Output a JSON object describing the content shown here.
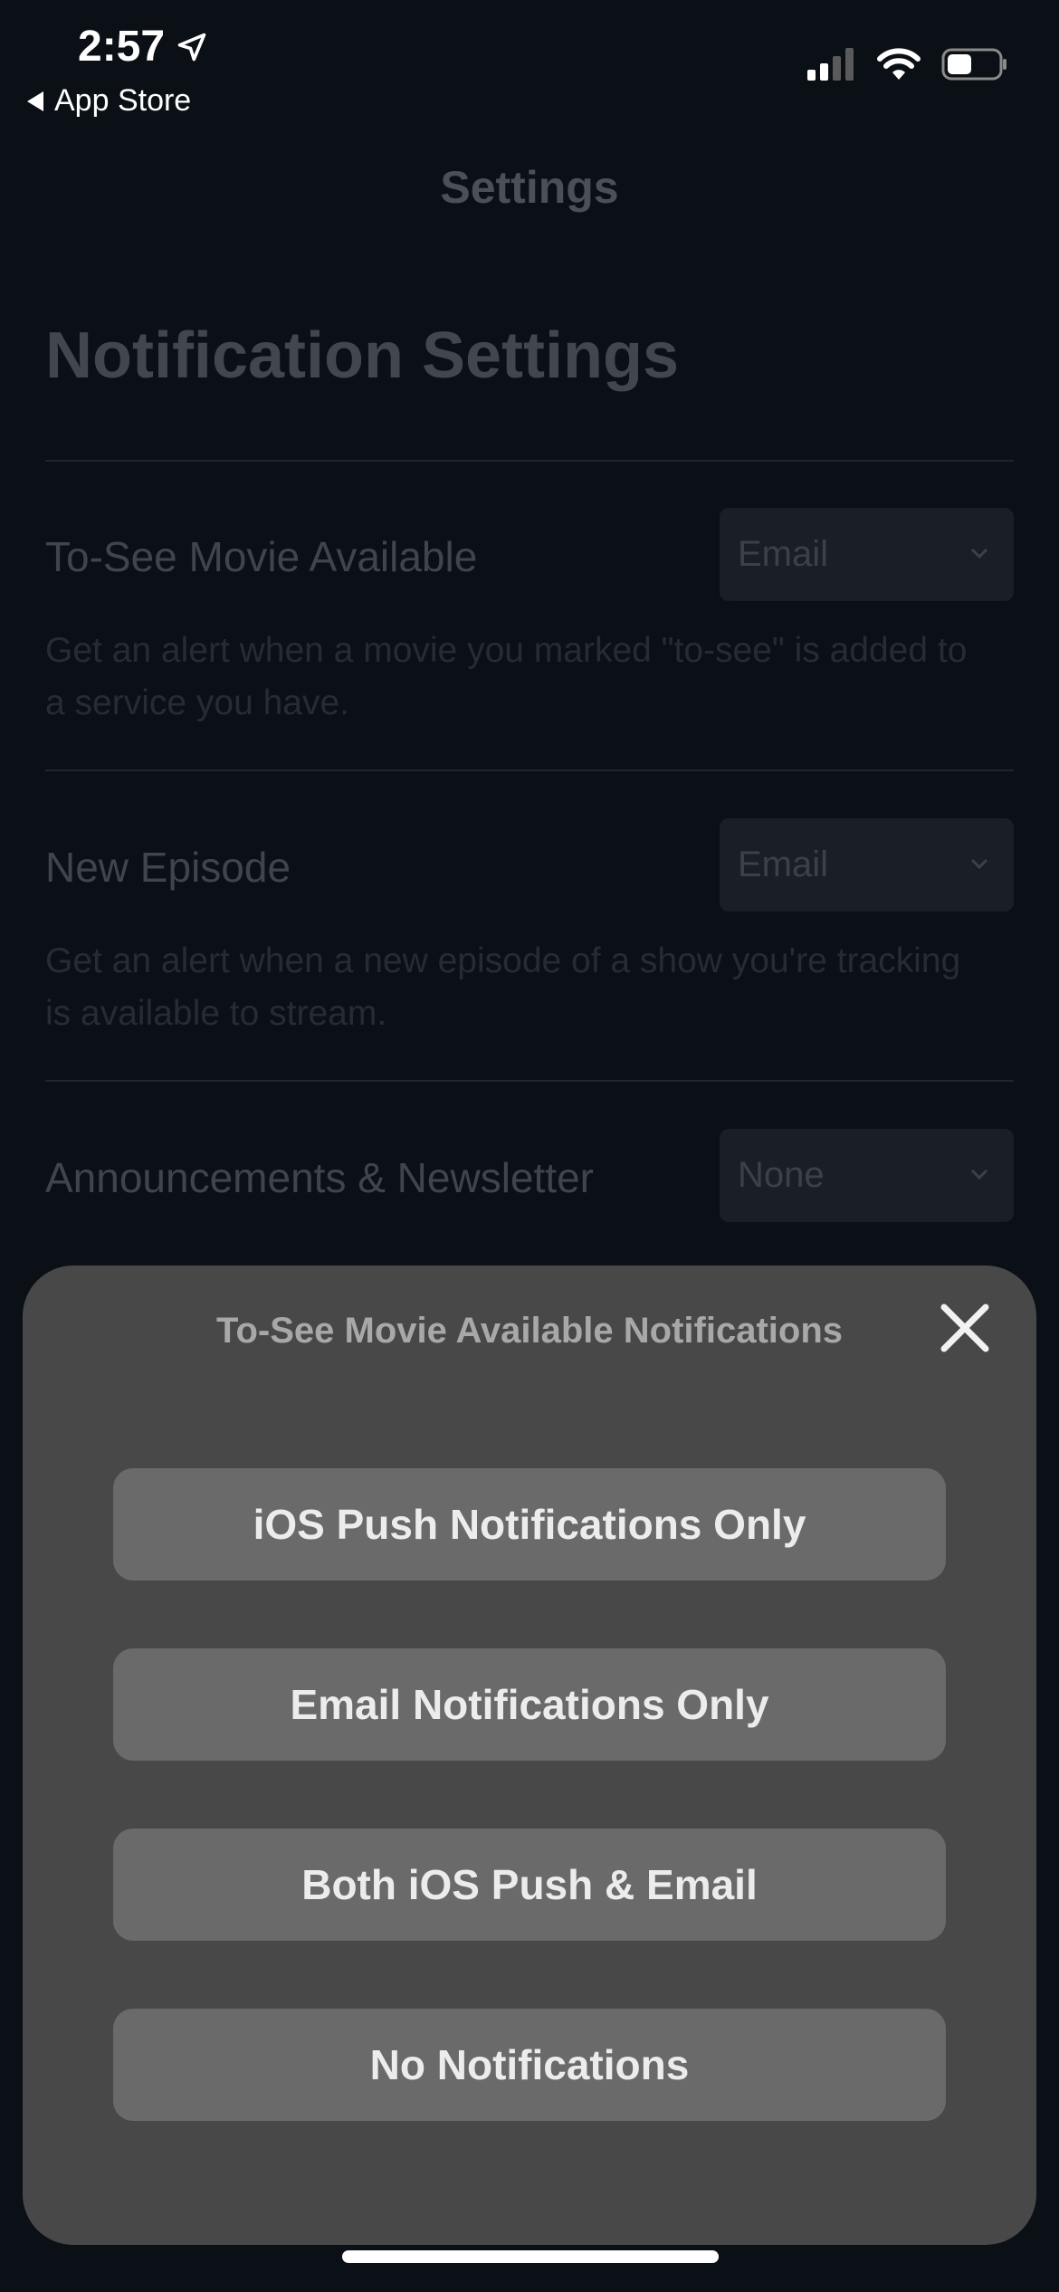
{
  "status_bar": {
    "time": "2:57",
    "back_label": "App Store",
    "icons": [
      "location-arrow-icon",
      "signal-icon",
      "wifi-icon",
      "battery-icon"
    ]
  },
  "nav": {
    "title": "Settings"
  },
  "page": {
    "heading": "Notification Settings",
    "settings": [
      {
        "label": "To-See Movie Available",
        "value": "Email",
        "description": "Get an alert when a movie you marked \"to-see\" is added to a service you have."
      },
      {
        "label": "New Episode",
        "value": "Email",
        "description": "Get an alert when a new episode of a show you're tracking is available to stream."
      },
      {
        "label": "Announcements & Newsletter",
        "value": "None"
      }
    ]
  },
  "sheet": {
    "title": "To-See Movie Available Notifications",
    "options": [
      "iOS Push Notifications Only",
      "Email Notifications Only",
      "Both iOS Push & Email",
      "No Notifications"
    ]
  },
  "colors": {
    "background": "#0b1016",
    "sheet": "#484848",
    "option_button": "#6a6a6a"
  }
}
